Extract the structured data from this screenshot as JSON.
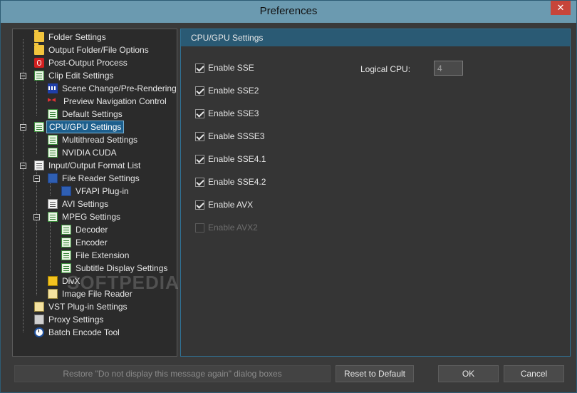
{
  "window": {
    "title": "Preferences",
    "close_label": "✕"
  },
  "tree": {
    "items": [
      {
        "label": "Folder Settings"
      },
      {
        "label": "Output Folder/File Options"
      },
      {
        "label": "Post-Output Process"
      },
      {
        "label": "Clip Edit Settings"
      },
      {
        "label": "Scene Change/Pre-Rendering"
      },
      {
        "label": "Preview Navigation Control"
      },
      {
        "label": "Default Settings"
      },
      {
        "label": "CPU/GPU Settings"
      },
      {
        "label": "Multithread Settings"
      },
      {
        "label": "NVIDIA CUDA"
      },
      {
        "label": "Input/Output Format List"
      },
      {
        "label": "File Reader Settings"
      },
      {
        "label": "VFAPI Plug-in"
      },
      {
        "label": "AVI Settings"
      },
      {
        "label": "MPEG Settings"
      },
      {
        "label": "Decoder"
      },
      {
        "label": "Encoder"
      },
      {
        "label": "File Extension"
      },
      {
        "label": "Subtitle Display Settings"
      },
      {
        "label": "DivX"
      },
      {
        "label": "Image File Reader"
      },
      {
        "label": "VST Plug-in Settings"
      },
      {
        "label": "Proxy Settings"
      },
      {
        "label": "Batch Encode Tool"
      }
    ],
    "selected": "CPU/GPU Settings"
  },
  "panel": {
    "header": "CPU/GPU Settings",
    "checks": [
      {
        "label": "Enable SSE",
        "checked": true
      },
      {
        "label": "Enable SSE2",
        "checked": true
      },
      {
        "label": "Enable SSE3",
        "checked": true
      },
      {
        "label": "Enable SSSE3",
        "checked": true
      },
      {
        "label": "Enable SSE4.1",
        "checked": true
      },
      {
        "label": "Enable SSE4.2",
        "checked": true
      },
      {
        "label": "Enable AVX",
        "checked": true
      },
      {
        "label": "Enable AVX2",
        "checked": false,
        "disabled": true
      }
    ],
    "logical_cpu_label": "Logical CPU:",
    "logical_cpu_value": "4"
  },
  "buttons": {
    "restore": "Restore \"Do not display this message again\" dialog boxes",
    "reset": "Reset to Default",
    "ok": "OK",
    "cancel": "Cancel"
  },
  "watermark": "SOFTPEDIA"
}
